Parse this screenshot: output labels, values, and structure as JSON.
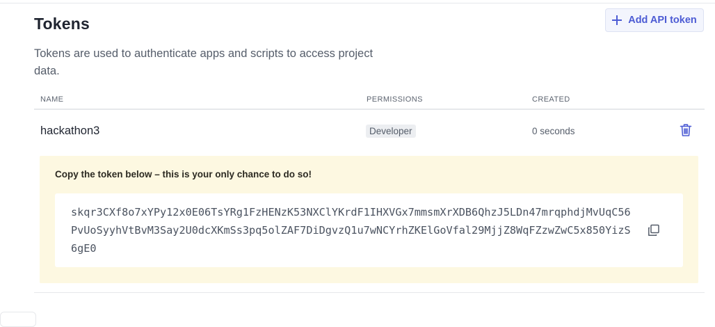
{
  "section": {
    "title": "Tokens",
    "description": "Tokens are used to authenticate apps and scripts to access project data."
  },
  "actions": {
    "add_token_label": "Add API token",
    "add_icon": "plus-icon"
  },
  "table": {
    "columns": [
      "NAME",
      "PERMISSIONS",
      "CREATED"
    ],
    "rows": [
      {
        "name": "hackathon3",
        "permission": "Developer",
        "created": "0 seconds",
        "delete_icon": "trash-icon"
      }
    ]
  },
  "new_token": {
    "notice": "Copy the token below – this is your only chance to do so!",
    "token": "skqr3CXf8o7xYPy12x0E06TsYRg1FzHENzK53NXClYKrdF1IHXVGx7mmsmXrXDB6QhzJ5LDn47mrqphdjMvUqC56PvUoSyyhVtBvM3Say2U0dcXKmSs3pq5olZAF7DiDgvzQ1u7wNCYrhZKElGoVfal29MjjZ8WqFZzwZwC5x850YizS6gE0",
    "copy_icon": "copy-icon"
  },
  "colors": {
    "accent": "#4c5bd4",
    "notice_background": "#fdf8e1",
    "badge_background": "#eceef1"
  }
}
